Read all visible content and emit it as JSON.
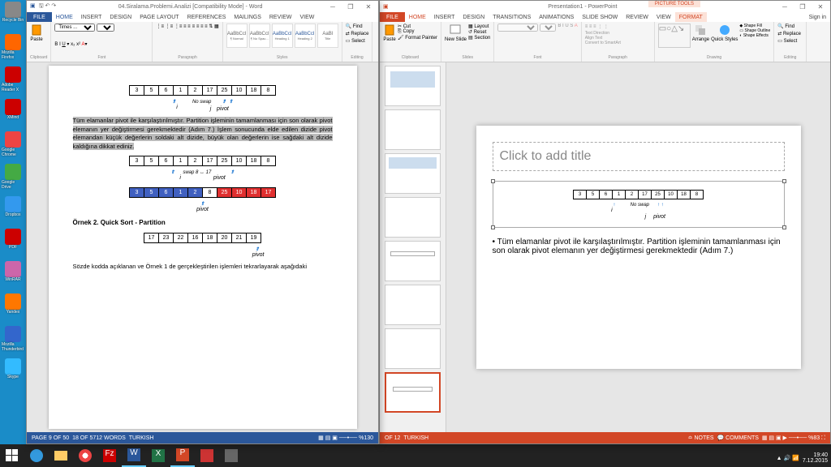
{
  "desktop_icons": [
    {
      "label": "Recycle Bin",
      "color": "#888"
    },
    {
      "label": "Mozilla Firefox",
      "color": "#f60"
    },
    {
      "label": "Adobe Reader X",
      "color": "#c00"
    },
    {
      "label": "XMind",
      "color": "#c00"
    },
    {
      "label": "Google Chrome",
      "color": "#e44"
    },
    {
      "label": "Google Drive",
      "color": "#4a4"
    },
    {
      "label": "Dropbox",
      "color": "#39e"
    },
    {
      "label": "PDF",
      "color": "#c00"
    },
    {
      "label": "WinRAR",
      "color": "#c6a"
    },
    {
      "label": "Yandex",
      "color": "#f70"
    },
    {
      "label": "Mozilla Thunderbird",
      "color": "#36c"
    },
    {
      "label": "Skype",
      "color": "#3bf"
    }
  ],
  "word": {
    "title": "04.Siralama.Problemi.Analizi [Compatibility Mode] - Word",
    "tabs": [
      "HOME",
      "INSERT",
      "DESIGN",
      "PAGE LAYOUT",
      "REFERENCES",
      "MAILINGS",
      "REVIEW",
      "VIEW"
    ],
    "file": "FILE",
    "groups": {
      "clipboard": "Clipboard",
      "font": "Font",
      "paragraph": "Paragraph",
      "styles": "Styles",
      "editing": "Editing"
    },
    "paste": "Paste",
    "find": "Find",
    "replace": "Replace",
    "select": "Select",
    "styles_list": [
      "AaBbCcI",
      "AaBbCcI",
      "AaBbCcI",
      "AaBbCcI",
      "AaBbCcI",
      "AaBl"
    ],
    "styles_names": [
      "¶ Normal",
      "¶ No Spac...",
      "Heading 1",
      "Heading 2",
      "Title",
      ""
    ],
    "page": {
      "array1": [
        "3",
        "5",
        "6",
        "1",
        "2",
        "17",
        "25",
        "10",
        "18",
        "8"
      ],
      "noswap": "No swap",
      "i": "i",
      "j": "j",
      "pivot": "pivot",
      "para1": "Tüm elamanlar pivot ile karşılaştırılmıştır. Partition işleminin tamamlanması için son olarak pivot elemanın yer değiştirmesi gerekmektedir (Adım 7.) İşlem sonucunda elde edilen dizide pivot elemandan küçük değerlerin soldaki alt dizide, büyük olan değerlerin ise sağdaki alt dizide kaldığına dikkat ediniz.",
      "array2": [
        "3",
        "5",
        "6",
        "1",
        "2",
        "17",
        "25",
        "10",
        "18",
        "8"
      ],
      "swap": "swap 8 ↔ 17",
      "array3": [
        "3",
        "5",
        "6",
        "1",
        "2",
        "8",
        "25",
        "10",
        "18",
        "17"
      ],
      "heading": "Örnek 2. Quick Sort - Partition",
      "array4": [
        "17",
        "23",
        "22",
        "16",
        "18",
        "20",
        "21",
        "19"
      ],
      "para2": "Sözde kodda açıklanan ve Örnek 1 de gerçekleştirilen işlemleri tekrarlayarak aşağıdaki"
    },
    "status": {
      "page": "PAGE 9 OF 50",
      "words": "18 OF 5712 WORDS",
      "lang": "TURKISH",
      "zoom": "%130"
    }
  },
  "ppt": {
    "title": "Presentation1 - PowerPoint",
    "tool_tab": "PICTURE TOOLS",
    "tabs": [
      "HOME",
      "INSERT",
      "DESIGN",
      "TRANSITIONS",
      "ANIMATIONS",
      "SLIDE SHOW",
      "REVIEW",
      "VIEW",
      "FORMAT"
    ],
    "file": "FILE",
    "signin": "Sign in",
    "groups": {
      "clipboard": "Clipboard",
      "slides": "Slides",
      "font": "Font",
      "paragraph": "Paragraph",
      "drawing": "Drawing",
      "editing": "Editing"
    },
    "paste": "Paste",
    "cut": "Cut",
    "copy": "Copy",
    "fmtpaint": "Format Painter",
    "newslide": "New Slide",
    "layout": "Layout",
    "reset": "Reset",
    "section": "Section",
    "textdir": "Text Direction",
    "aligntext": "Align Text",
    "smartart": "Convert to SmartArt",
    "arrange": "Arrange",
    "quickstyles": "Quick Styles",
    "shapefill": "Shape Fill",
    "shapeoutline": "Shape Outline",
    "shapeeffects": "Shape Effects",
    "find": "Find",
    "replace": "Replace",
    "select": "Select",
    "slide": {
      "title_placeholder": "Click to add title",
      "array": [
        "3",
        "5",
        "6",
        "1",
        "2",
        "17",
        "25",
        "10",
        "18",
        "8"
      ],
      "noswap": "No swap",
      "i": "i",
      "j": "j",
      "pivot": "pivot",
      "bullet": "Tüm elamanlar pivot ile karşılaştırılmıştır. Partition işleminin tamamlanması için son olarak pivot elemanın yer değiştirmesi gerekmektedir (Adım 7.)"
    },
    "status": {
      "slide": "OF 12",
      "lang": "TURKISH",
      "notes": "NOTES",
      "comments": "COMMENTS",
      "zoom": "%83"
    }
  },
  "taskbar": {
    "time": "19:40",
    "date": "7.12.2015"
  }
}
